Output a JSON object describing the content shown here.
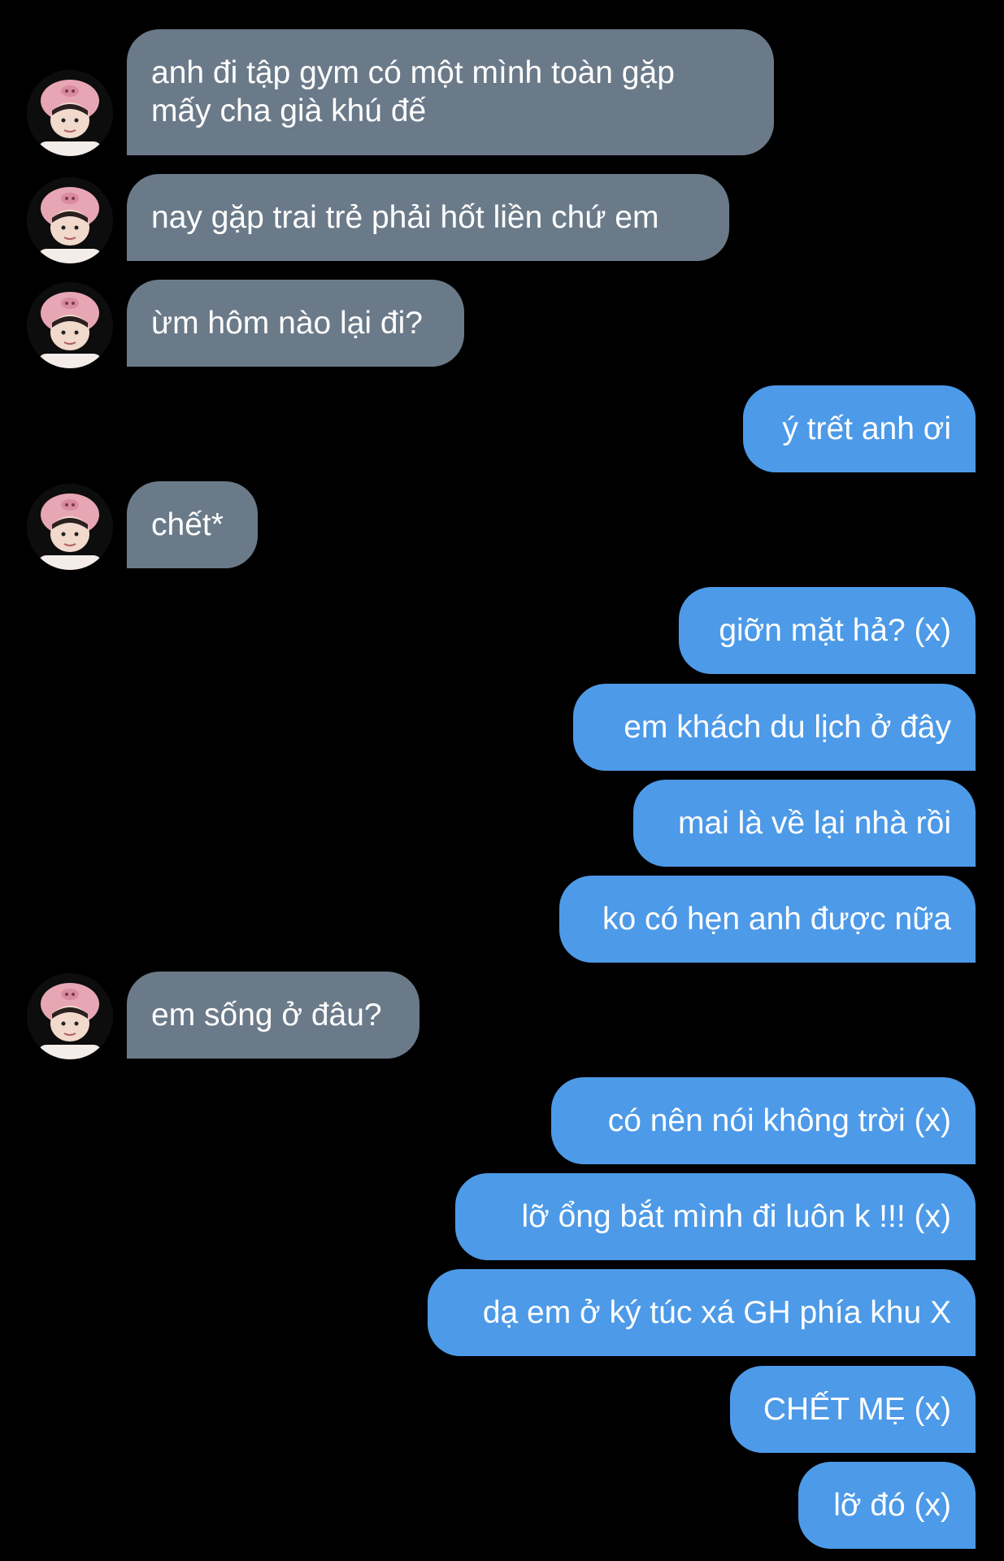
{
  "colors": {
    "background": "#000000",
    "incoming_bubble": "#6b7a89",
    "outgoing_bubble": "#4d9ae8",
    "text": "#ffffff"
  },
  "avatar": {
    "icon": "avatar-pink-pig-hat"
  },
  "messages": [
    {
      "sender": "other",
      "text_lines": [
        "anh đi tập gym có một mình toàn gặp",
        "mấy cha già khú đế"
      ]
    },
    {
      "sender": "other",
      "text": "nay gặp trai trẻ phải hốt liền chứ em"
    },
    {
      "sender": "other",
      "text": "ừm hôm nào lại đi?"
    },
    {
      "sender": "me",
      "text": "ý trết anh ơi"
    },
    {
      "sender": "other",
      "text": "chết*"
    },
    {
      "sender": "me",
      "text": "giỡn mặt hả? (x)"
    },
    {
      "sender": "me",
      "text": "em khách du lịch ở đây"
    },
    {
      "sender": "me",
      "text": "mai là về lại nhà rồi"
    },
    {
      "sender": "me",
      "text": "ko có hẹn anh được nữa"
    },
    {
      "sender": "other",
      "text": "em sống ở đâu?"
    },
    {
      "sender": "me",
      "text": "có nên nói không trời (x)"
    },
    {
      "sender": "me",
      "text": "lỡ ổng bắt mình đi luôn k !!! (x)"
    },
    {
      "sender": "me",
      "text": "dạ em ở ký túc xá GH phía khu X"
    },
    {
      "sender": "me",
      "text": "CHẾT MẸ (x)"
    },
    {
      "sender": "me",
      "text": "lỡ đó (x)"
    }
  ]
}
